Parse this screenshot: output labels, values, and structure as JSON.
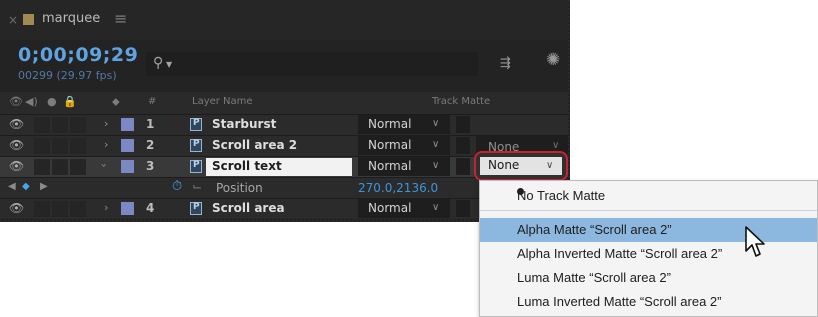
{
  "panel": {
    "tab_close": "×",
    "tab_name": "marquee",
    "tab_menu": "≡",
    "timecode": "0;00;09;29",
    "frames_fps": "00299 (29.97 fps)",
    "search_placeholder": "",
    "search_icon_glyph": "⚲",
    "search_caret": "▼"
  },
  "header": {
    "layer_name": "Layer Name",
    "track_matte": "Track Matte",
    "number": "#"
  },
  "layers": [
    {
      "num": "1",
      "name": "Starburst",
      "mode": "Normal",
      "track_matte": ""
    },
    {
      "num": "2",
      "name": "Scroll area 2",
      "mode": "Normal",
      "track_matte": "None"
    },
    {
      "num": "3",
      "name": "Scroll text",
      "mode": "Normal",
      "track_matte": "None"
    },
    {
      "num": "4",
      "name": "Scroll area",
      "mode": "Normal",
      "track_matte": ""
    }
  ],
  "property": {
    "name": "Position",
    "value": "270.0,2136.0"
  },
  "menu": {
    "items": [
      {
        "label": "No Track Matte",
        "checked": true
      },
      {
        "label": "Alpha Matte “Scroll area 2”",
        "highlighted": true
      },
      {
        "label": "Alpha Inverted Matte “Scroll area 2”"
      },
      {
        "label": "Luma Matte “Scroll area 2”"
      },
      {
        "label": "Luma Inverted Matte “Scroll area 2”"
      }
    ]
  },
  "colors": {
    "timecode": "#5fa3e1",
    "label_lavender": "#7b88c4",
    "highlight_annotation": "#c82232",
    "menu_highlight": "#8cb7de"
  }
}
